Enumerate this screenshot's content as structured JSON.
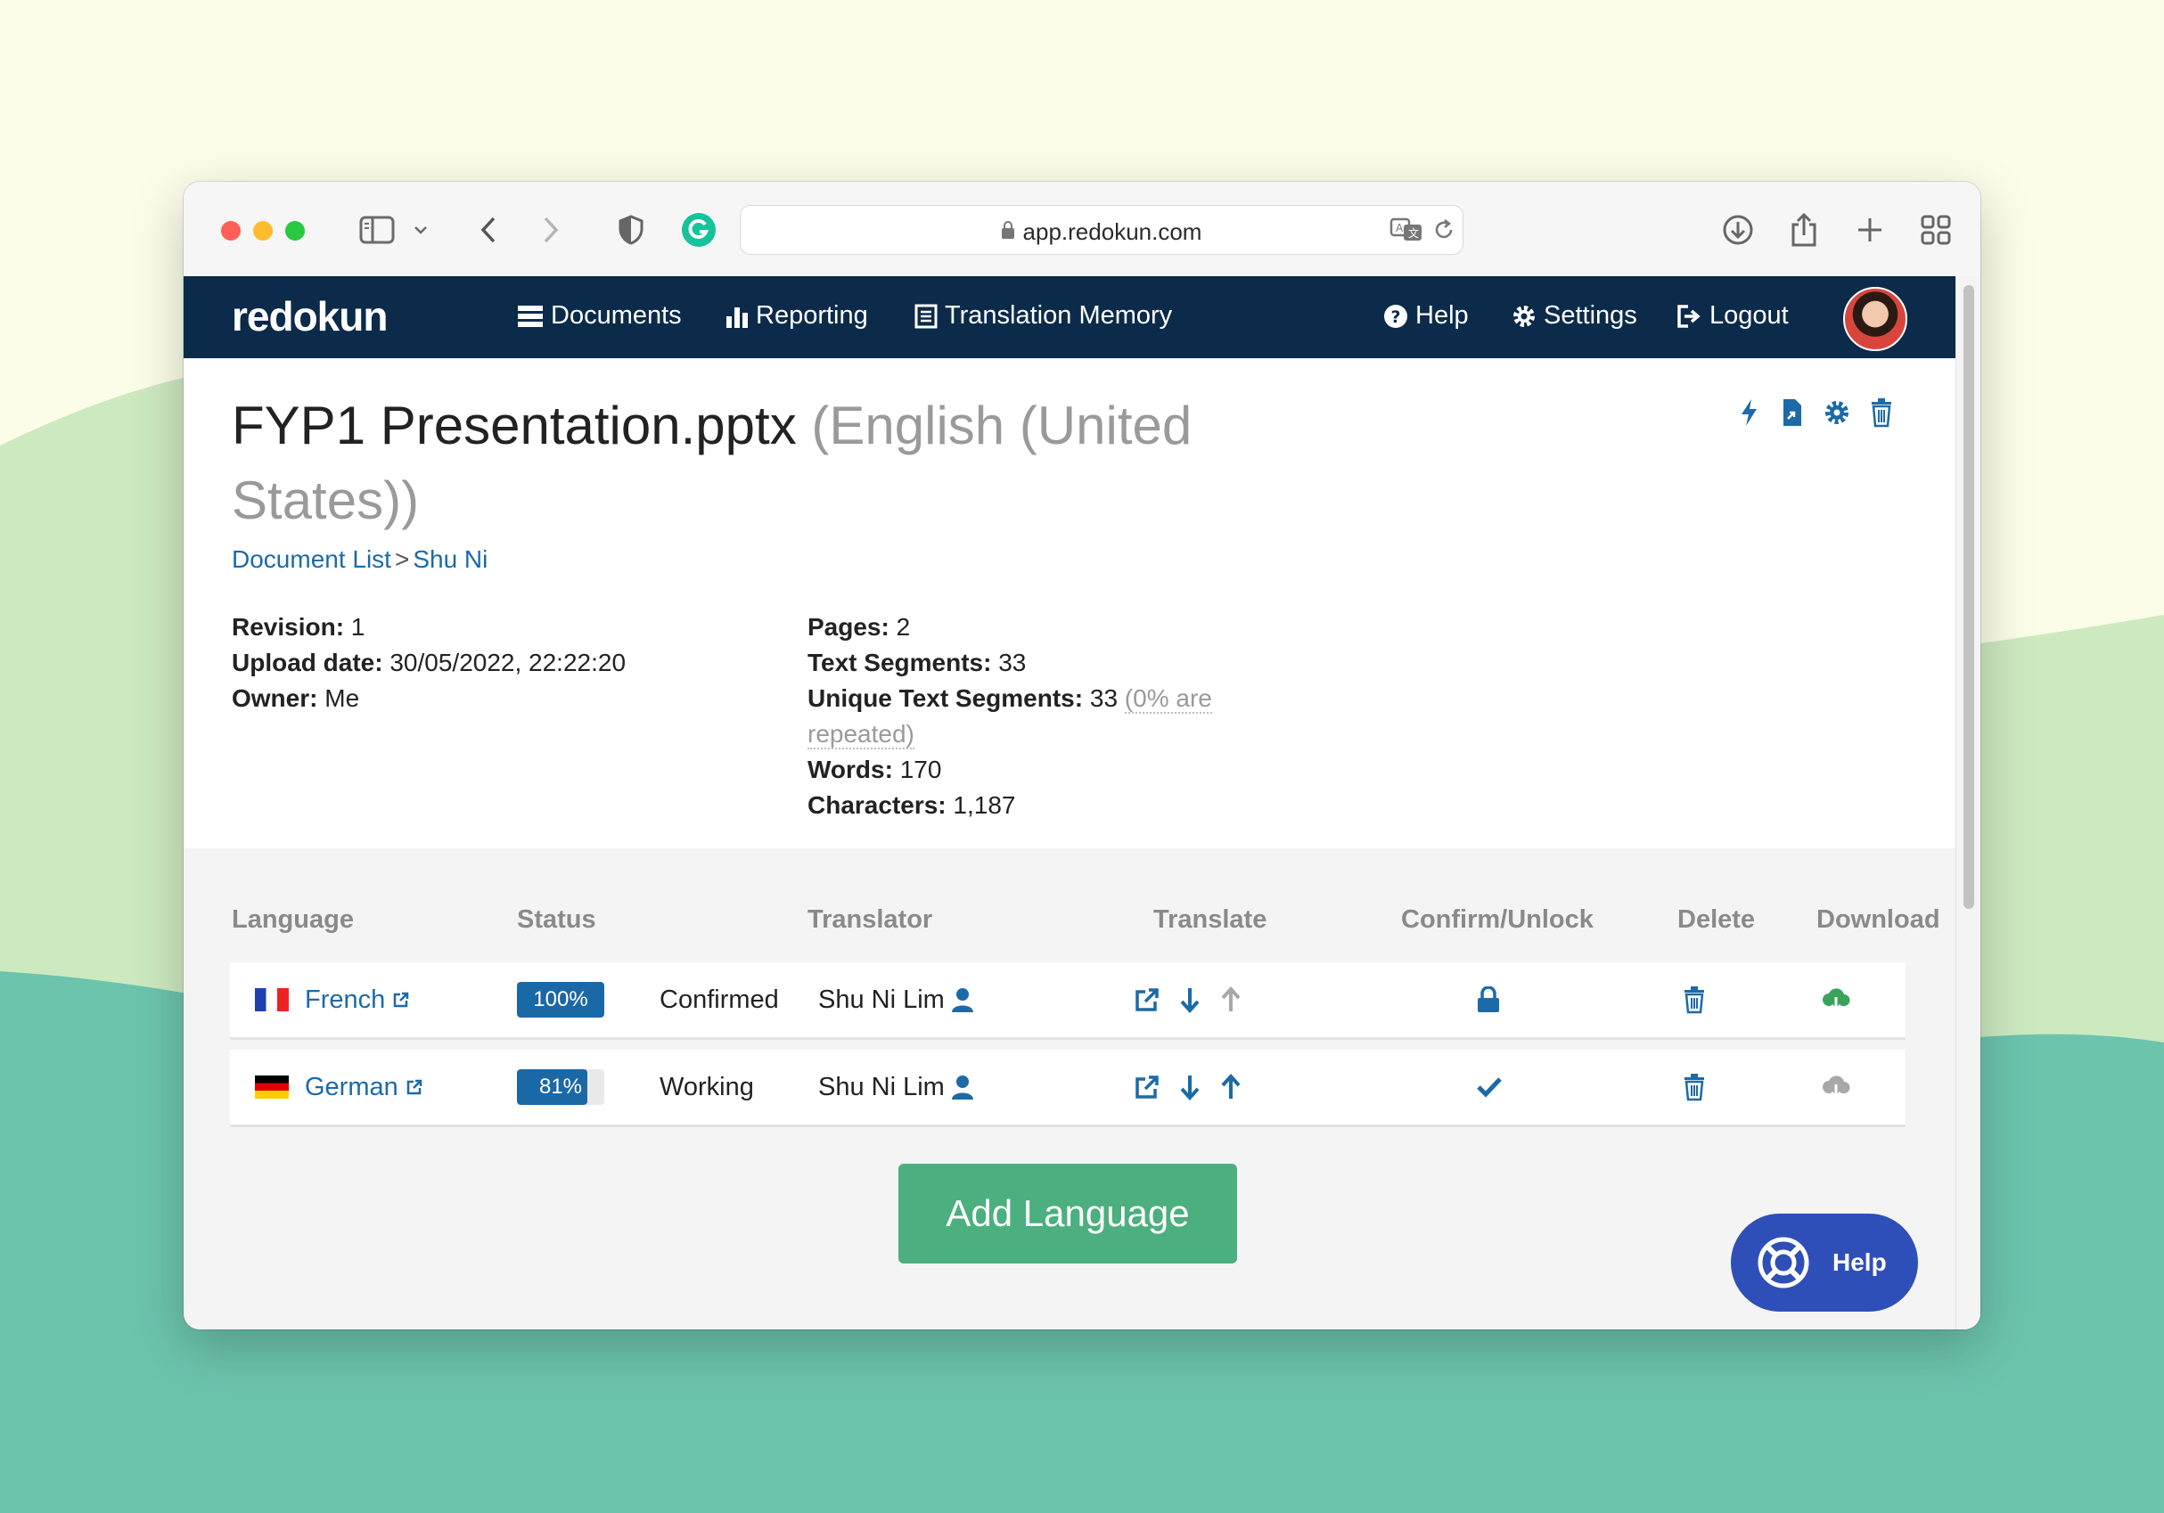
{
  "browser": {
    "url": "app.redokun.com"
  },
  "nav": {
    "logo": "redokun",
    "documents": "Documents",
    "reporting": "Reporting",
    "translation_memory": "Translation Memory",
    "help": "Help",
    "settings": "Settings",
    "logout": "Logout"
  },
  "document": {
    "title": "FYP1 Presentation.pptx",
    "source_language": "(English (United States))",
    "breadcrumb": [
      "Document List",
      ">",
      "Shu Ni"
    ],
    "meta_left": [
      {
        "label": "Revision:",
        "value": " 1"
      },
      {
        "label": "Upload date:",
        "value": " 30/05/2022, 22:22:20"
      },
      {
        "label": "Owner:",
        "value": " Me"
      }
    ],
    "meta_right": {
      "pages_label": "Pages:",
      "pages": " 2",
      "text_segments_label": "Text Segments:",
      "text_segments": " 33",
      "unique_label": "Unique Text Segments:",
      "unique": " 33 ",
      "unique_note": "(0% are repeated)",
      "words_label": "Words:",
      "words": " 170",
      "characters_label": "Characters:",
      "characters": " 1,187"
    }
  },
  "table": {
    "headers": [
      "Language",
      "Status",
      "Translator",
      "Translate",
      "Confirm/Unlock",
      "Delete",
      "Download"
    ],
    "rows": [
      {
        "language": "French",
        "progress": 100,
        "progress_label": "100%",
        "state": "Confirmed",
        "translator": "Shu Ni Lim",
        "confirm_action": "lock-icon",
        "download_enabled": true
      },
      {
        "language": "German",
        "progress": 81,
        "progress_label": "81%",
        "state": "Working",
        "translator": "Shu Ni Lim",
        "confirm_action": "checkmark-icon",
        "download_enabled": false
      }
    ]
  },
  "add_language_label": "Add Language",
  "help_fab_label": "Help",
  "colors": {
    "nav_bg": "#0c2b4a",
    "link": "#1c6aa8",
    "primary_button": "#4caf7f",
    "help_fab": "#2f4fb8",
    "badge": "#1b68a6"
  }
}
